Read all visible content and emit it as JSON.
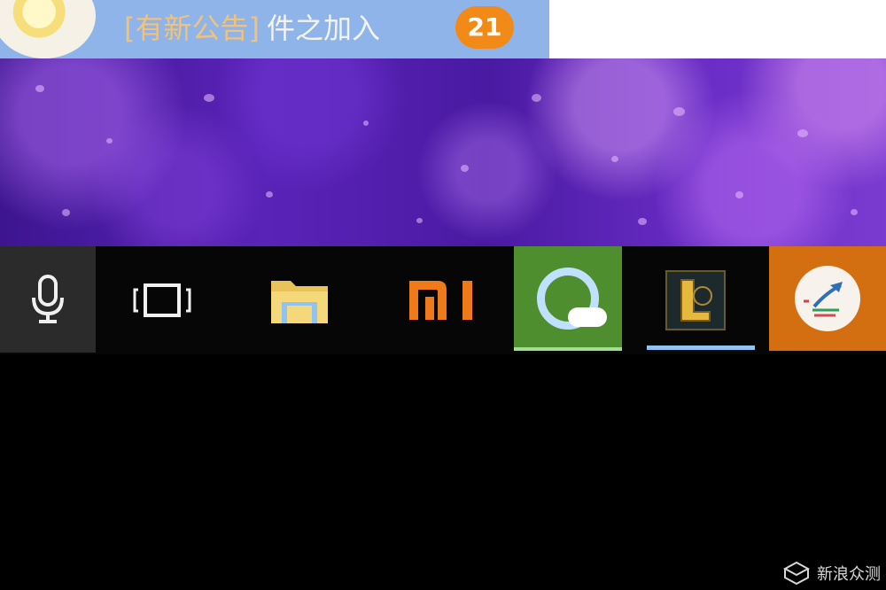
{
  "notification": {
    "tag": "[有新公告]",
    "message": "件之加入",
    "badge_count": "21"
  },
  "taskbar": {
    "items": [
      {
        "name": "microphone",
        "icon": "microphone-icon"
      },
      {
        "name": "task-view",
        "icon": "task-view-icon"
      },
      {
        "name": "file-explorer",
        "icon": "folder-icon"
      },
      {
        "name": "xiaomi",
        "icon": "mi-logo-icon",
        "label": "mi"
      },
      {
        "name": "qq-browser",
        "icon": "qq-cloud-icon"
      },
      {
        "name": "league-of-legends",
        "icon": "lol-icon",
        "label": "L"
      },
      {
        "name": "app-orange",
        "icon": "app-circle-icon"
      }
    ]
  },
  "watermark": {
    "text": "新浪众测"
  },
  "colors": {
    "top_bar": "#8fb4ea",
    "badge": "#f28a17",
    "taskbar_bg": "#060606",
    "qq_tile": "#4f8e2f",
    "app7_tile": "#d36f11",
    "active_underline": "#8fc4f2"
  }
}
